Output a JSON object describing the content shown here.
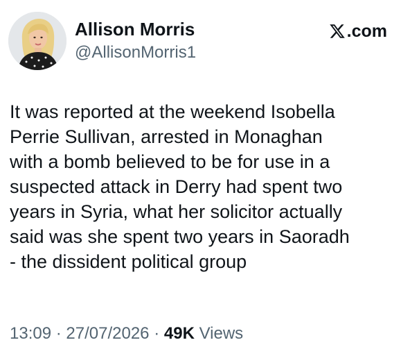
{
  "author": {
    "display_name": "Allison Morris",
    "handle": "@AllisonMorris1",
    "avatar_icon": "profile-photo"
  },
  "brand": {
    "icon": "x-logo-icon",
    "suffix": ".com"
  },
  "tweet": {
    "text": "It was reported at the weekend Isobella\nPerrie Sullivan, arrested in Monaghan\nwith a bomb believed to be for use in a\nsuspected attack in Derry had spent two\nyears in Syria, what her solicitor actually\nsaid was she spent two years in Saoradh\n- the dissident political group"
  },
  "meta": {
    "time": "13:09",
    "separator": "·",
    "date": "27/07/2026",
    "views_count": "49K",
    "views_label": "Views"
  },
  "colors": {
    "text_primary": "#0f1419",
    "text_secondary": "#536471",
    "background": "#ffffff"
  }
}
